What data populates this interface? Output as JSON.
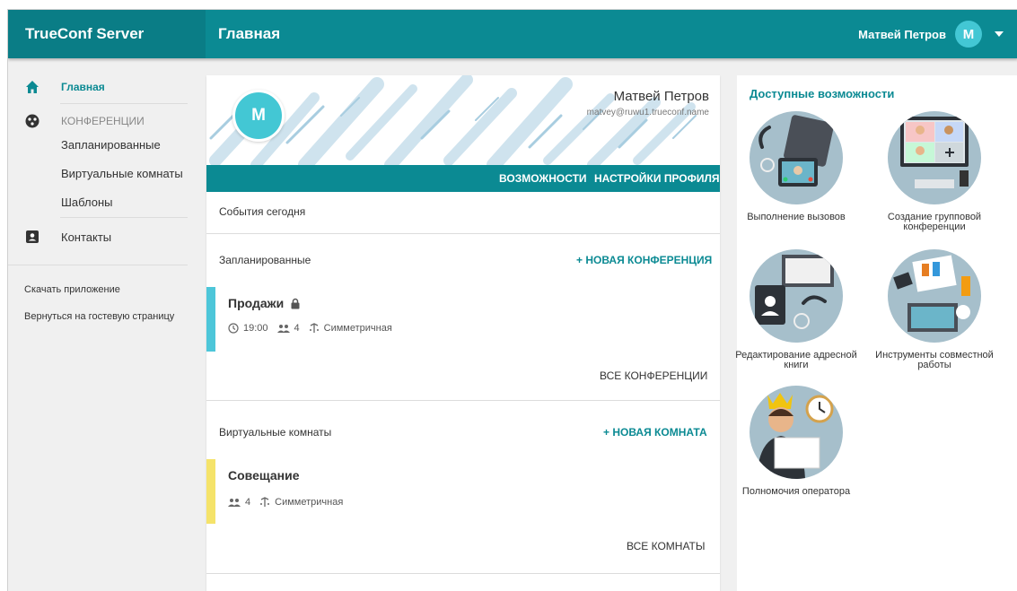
{
  "header": {
    "brand": "TrueConf Server",
    "page_title": "Главная",
    "user_name": "Матвей Петров",
    "user_initial": "М"
  },
  "sidebar": {
    "items": [
      {
        "label": "Главная",
        "icon": "home-icon",
        "active": true
      },
      {
        "label": "КОНФЕРЕНЦИИ",
        "icon": "conferences-icon"
      },
      {
        "label": "Запланированные"
      },
      {
        "label": "Виртуальные комнаты"
      },
      {
        "label": "Шаблоны"
      },
      {
        "label": "Контакты",
        "icon": "contacts-icon"
      }
    ],
    "download_app": "Скачать приложение",
    "back_to_guest": "Вернуться на гостевую страницу"
  },
  "profile": {
    "initial": "М",
    "name": "Матвей Петров",
    "email": "matvey@ruwu1.trueconf.name",
    "tabs": [
      "ВОЗМОЖНОСТИ",
      "НАСТРОЙКИ ПРОФИЛЯ"
    ]
  },
  "events_today": "События сегодня",
  "scheduled": {
    "title": "Запланированные",
    "new_link": "+ НОВАЯ КОНФЕРЕНЦИЯ",
    "conference": {
      "name": "Продажи",
      "time": "19:00",
      "participants": "4",
      "mode": "Симметричная",
      "bar_color": "#4dc6d9"
    },
    "all_link": "ВСЕ КОНФЕРЕНЦИИ"
  },
  "rooms": {
    "title": "Виртуальные комнаты",
    "new_link": "+ НОВАЯ КОМНАТА",
    "room": {
      "name": "Совещание",
      "participants": "4",
      "mode": "Симметричная",
      "bar_color": "#f5e36a"
    },
    "all_link": "ВСЕ КОМНАТЫ"
  },
  "features": {
    "title": "Доступные возможности",
    "items": [
      {
        "label": "Выполнение вызовов"
      },
      {
        "label": "Создание групповой конференции"
      },
      {
        "label": "Редактирование адресной книги"
      },
      {
        "label": "Инструменты совместной работы"
      },
      {
        "label": "Полномочия оператора"
      }
    ]
  },
  "colors": {
    "accent": "#0b8a93",
    "brand_bg": "#0a7d86",
    "avatar": "#43c7d4"
  }
}
